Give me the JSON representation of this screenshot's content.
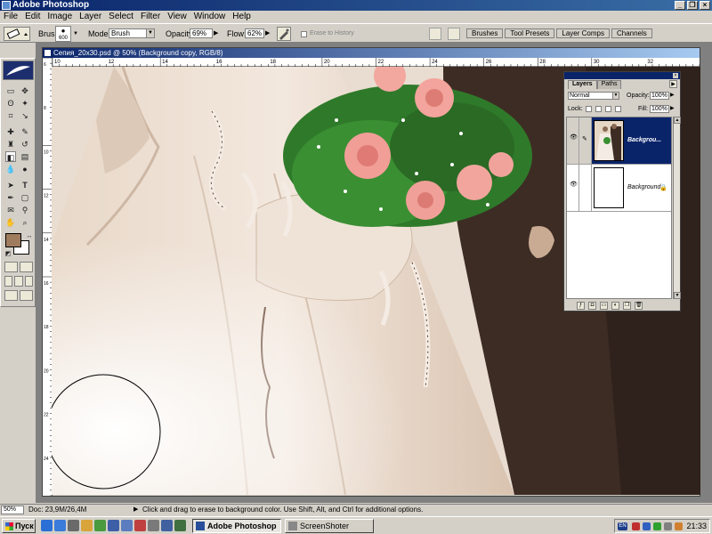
{
  "app": {
    "title": "Adobe Photoshop"
  },
  "window_controls": {
    "minimize": "_",
    "restore": "❐",
    "close": "×"
  },
  "menu": [
    "File",
    "Edit",
    "Image",
    "Layer",
    "Select",
    "Filter",
    "View",
    "Window",
    "Help"
  ],
  "options_bar": {
    "brush_label": "Brush:",
    "brush_size": "600",
    "mode_label": "Mode:",
    "mode_value": "Brush",
    "opacity_label": "Opacity:",
    "opacity_value": "69%",
    "flow_label": "Flow:",
    "flow_value": "62%",
    "erase_history_label": "Erase to History"
  },
  "palette_well": [
    "Brushes",
    "Tool Presets",
    "Layer Comps",
    "Channels"
  ],
  "document": {
    "title": "Сепия_20x30.psd @ 50% (Background copy, RGB/8)"
  },
  "ruler_top_labels": [
    "10",
    "12",
    "14",
    "16",
    "18",
    "20",
    "22",
    "24",
    "26",
    "28",
    "30",
    "32"
  ],
  "ruler_left_labels": [
    "6",
    "8",
    "10",
    "12",
    "14",
    "16",
    "18",
    "20",
    "22",
    "24"
  ],
  "colors": {
    "foreground": "#a07c5e",
    "background": "#ffffff",
    "highlight": "#0a246a"
  },
  "layers_panel": {
    "tabs": [
      "Layers",
      "Paths"
    ],
    "blend_mode": "Normal",
    "opacity_label": "Opacity:",
    "opacity_value": "100%",
    "lock_label": "Lock:",
    "fill_label": "Fill:",
    "fill_value": "100%",
    "layers": [
      {
        "name": "Backgrou...",
        "selected": true,
        "visible": true
      },
      {
        "name": "Background",
        "selected": false,
        "visible": true,
        "locked": true
      }
    ]
  },
  "status_bar": {
    "zoom": "50%",
    "doc_info": "Doc: 23,9M/26,4M",
    "message": "Click and drag to erase to background color. Use Shift, Alt, and Ctrl for additional options."
  },
  "taskbar": {
    "start_label": "Пуск",
    "tasks": [
      "Adobe Photoshop",
      "ScreenShoter"
    ],
    "lang": "EN",
    "clock": "21:33"
  }
}
